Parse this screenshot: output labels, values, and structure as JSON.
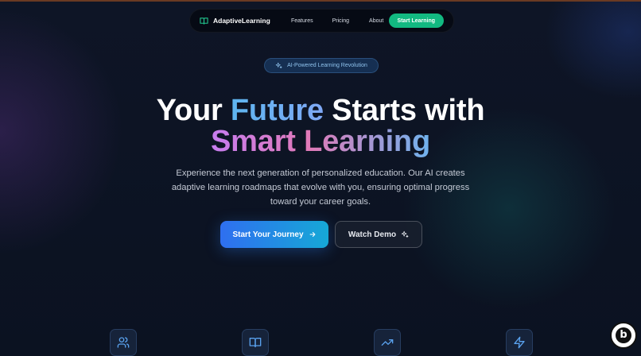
{
  "nav": {
    "brand": "AdaptiveLearning",
    "links": [
      "Features",
      "Pricing",
      "About"
    ],
    "cta": "Start Learning"
  },
  "hero": {
    "badge": "AI-Powered Learning Revolution",
    "headline": {
      "part1": "Your",
      "highlight1": "Future",
      "part2": "Starts with",
      "highlight2": "Smart Learning"
    },
    "subtitle": "Experience the next generation of personalized education. Our AI creates adaptive learning roadmaps that evolve with you, ensuring optimal progress toward your career goals.",
    "primary_button": "Start Your Journey",
    "secondary_button": "Watch Demo"
  },
  "features": {
    "icons": [
      "users-icon",
      "book-open-icon",
      "trending-up-icon",
      "zap-icon"
    ]
  },
  "colors": {
    "accent_green": "#12b981",
    "primary_blue": "#2f6ff0",
    "background": "#0c1322"
  }
}
